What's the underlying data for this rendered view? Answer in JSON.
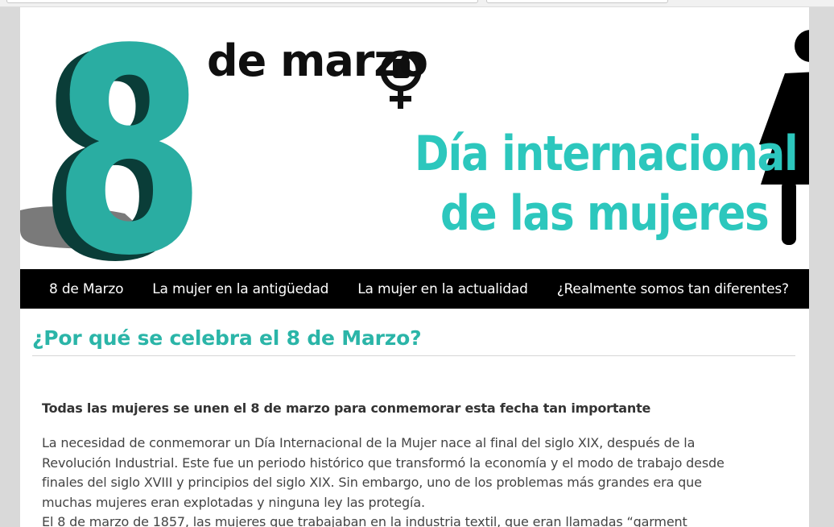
{
  "banner": {
    "number": "8",
    "title": "de marzo",
    "heading_line1": "Día internacional",
    "heading_line2": "de las mujeres",
    "colors": {
      "accent": "#2cc7bd",
      "dark": "#0f0f0f"
    },
    "icons": [
      "feminist-fist-icon",
      "woman-figure-icon"
    ]
  },
  "nav": {
    "items": [
      {
        "label": "8 de Marzo"
      },
      {
        "label": "La mujer en la antigüedad"
      },
      {
        "label": "La mujer en la actualidad"
      },
      {
        "label": "¿Realmente somos tan diferentes?"
      }
    ]
  },
  "article": {
    "title": "¿Por qué se celebra el 8 de Marzo?",
    "lead": "Todas las mujeres se unen el 8 de marzo para conmemorar esta fecha tan importante",
    "paragraphs": [
      "La necesidad de conmemorar un Día Internacional de la Mujer nace al final del siglo XIX, después de la Revolución Industrial. Este fue un periodo histórico que transformó la economía y el modo de trabajo desde finales del siglo XVIII y principios del siglo XIX. Sin embargo, uno de los problemas más grandes era que muchas mujeres eran explotadas y ninguna ley las protegía.",
      "El 8 de marzo de 1857, las mujeres que trabajaban en la industria textil, que eran llamadas “garment"
    ]
  },
  "colors": {
    "nav_bg": "#000000",
    "title": "#2bb5a8",
    "text": "#444444"
  }
}
